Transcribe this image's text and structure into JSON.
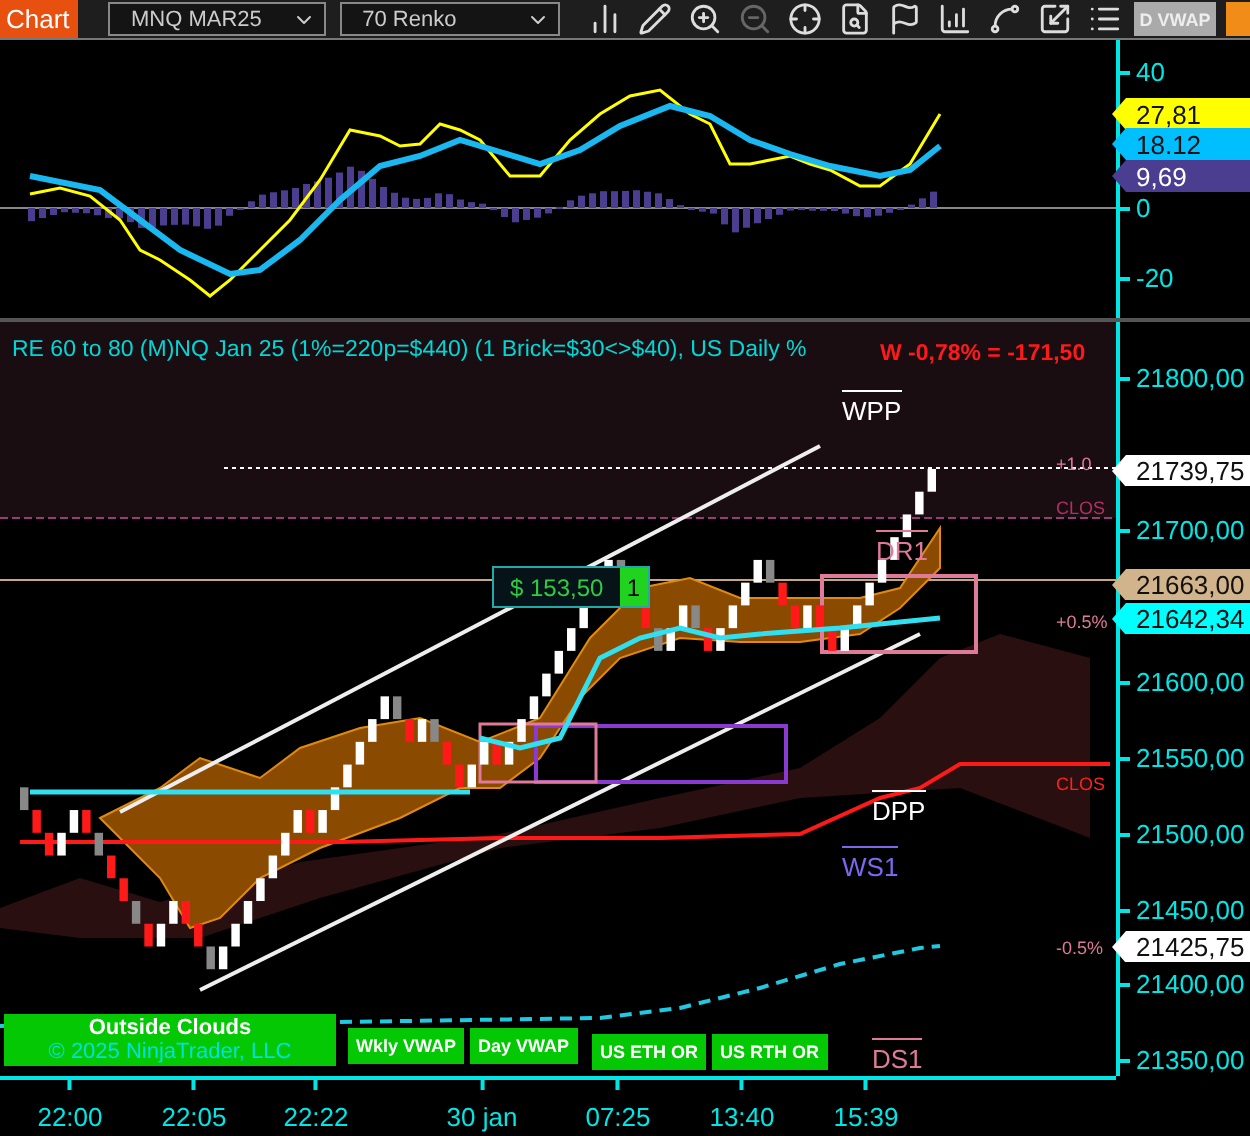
{
  "toolbar": {
    "chart_button": "Chart",
    "instrument": "MNQ MAR25",
    "bar_type": "70 Renko",
    "vwap_button": "D VWAP"
  },
  "oscillator": {
    "axis_ticks": [
      "40",
      "0",
      "-20"
    ],
    "value_flags": [
      {
        "label": "27,81",
        "color": "#ffff00"
      },
      {
        "label": "18.12",
        "color": "#00bfff"
      },
      {
        "label": "9,69",
        "color": "#4b3d8f"
      }
    ]
  },
  "price_panel": {
    "title": "RE 60 to 80 (M)NQ Jan 25 (1%=220p=$440) (1 Brick=$30<>$40), US Daily %",
    "weekly_result": "W -0,78% = -171,50",
    "axis_ticks": [
      "21800,00",
      "21700,00",
      "21600,00",
      "21550,00",
      "21500,00",
      "21450,00",
      "21400,00",
      "21350,00"
    ],
    "price_flags": [
      {
        "label": "21739,75",
        "color": "#ffffff"
      },
      {
        "label": "21663,00",
        "color": "#d2b48c"
      },
      {
        "label": "21642,34",
        "color": "#00ffff"
      },
      {
        "label": "21425,75",
        "color": "#ffffff"
      }
    ],
    "level_labels": [
      {
        "label": "WPP",
        "color": "#ffffff"
      },
      {
        "label": "DR1",
        "color": "#e07a9a"
      },
      {
        "label": "DPP",
        "color": "#ffffff"
      },
      {
        "label": "WS1",
        "color": "#7b68ee"
      },
      {
        "label": "DS1",
        "color": "#e07a9a"
      }
    ],
    "line_labels": [
      {
        "label": "+1.0",
        "color": "#e07a9a"
      },
      {
        "label": "CLOS",
        "color": "#b03060"
      },
      {
        "label": "+0.5%",
        "color": "#e07a9a"
      },
      {
        "label": "CLOS",
        "color": "#ff2020"
      },
      {
        "label": "-0.5%",
        "color": "#e07a9a"
      }
    ],
    "trade": {
      "pnl": "$ 153,50",
      "quantity": "1"
    },
    "main_button": "Outside Clouds",
    "copyright": "© 2025 NinjaTrader, LLC",
    "indicator_buttons": [
      "Wkly VWAP",
      "Day VWAP",
      "US ETH OR",
      "US RTH OR"
    ]
  },
  "time_axis": [
    "22:00",
    "22:05",
    "22:22",
    "30 jan",
    "07:25",
    "13:40",
    "15:39"
  ]
}
